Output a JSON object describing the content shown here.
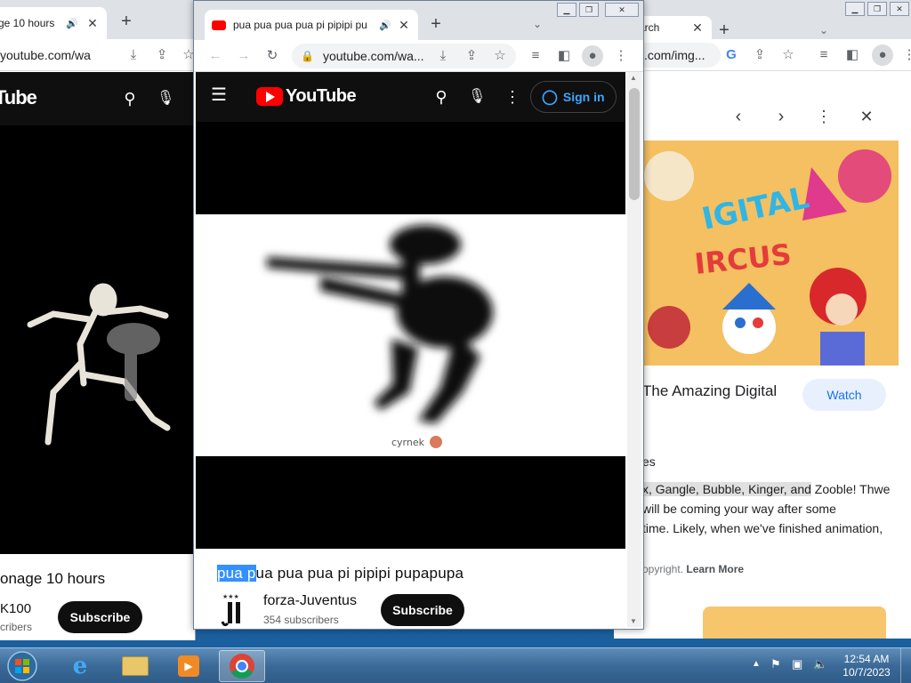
{
  "left_window": {
    "tab_title": "ge 10 hours",
    "url": "youtube.com/wa",
    "logo_text": "Tube",
    "video_title": "onage 10 hours",
    "subscriber_count": "K100",
    "subscribers_label": "cribers",
    "subscribe_label": "Subscribe"
  },
  "center_window": {
    "tab_title": "pua pua pua pua pi pipipi pu",
    "url": "youtube.com/wa...",
    "logo_text": "YouTube",
    "sign_in_label": "Sign in",
    "watermark": "cyrnek",
    "video_title_selected": "pua p",
    "video_title_rest": "ua pua pua pi pipipi pupapupa",
    "channel_name": "forza-Juventus",
    "subscriber_count": "354 subscribers",
    "subscribe_label": "Subscribe"
  },
  "right_window": {
    "tab_title": "arch",
    "url": ".com/img...",
    "video_title": "The Amazing Digital",
    "watch_label": "Watch",
    "section_label": "es",
    "description_highlight": "x, Gangle, Bubble, Kinger, and",
    "description_after": " Zooble! Thwe",
    "description_line2": "will be coming your way after some",
    "description_line3": "time. Likely, when we've finished animation,",
    "copyright_text": "opyright.",
    "learn_more_label": "Learn More",
    "image_title_text": "THE AMAZING DIGITAL CIRCUS"
  },
  "taskbar": {
    "time": "12:54 AM",
    "date": "10/7/2023"
  },
  "colors": {
    "youtube_red": "#ff0000",
    "selection_blue": "#3390ff",
    "taskbar_blue": "#3b6a98"
  }
}
